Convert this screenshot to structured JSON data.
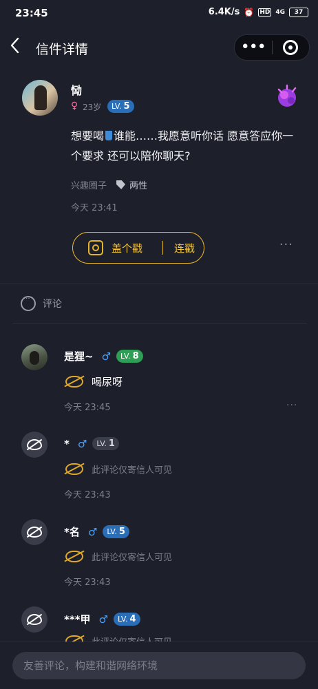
{
  "status_bar": {
    "time": "23:45",
    "speed": "6.4K/s",
    "alarm_icon": "alarm-icon",
    "hd": "HD",
    "signal": "4G",
    "battery": "37"
  },
  "nav": {
    "title": "信件详情",
    "back_icon": "chevron-left-icon",
    "more_icon": "more-dots-icon",
    "close_icon": "target-circle-icon"
  },
  "post": {
    "author": "恸",
    "gender_symbol": "♀",
    "age": "23岁",
    "level_prefix": "LV.",
    "level": "5",
    "content_before": "想要喝",
    "content_after": "谁能……我愿意听你话 愿意答应你一个要求 还可以陪你聊天?",
    "circle": "兴趣圈子",
    "tag": "两性",
    "time": "今天 23:41",
    "stamp_label": "盖个戳",
    "restamp_label": "连戳",
    "more": "···"
  },
  "comments_header": {
    "label": "评论"
  },
  "comments": [
    {
      "name": "是狸~",
      "gender": "♂",
      "level_prefix": "LV.",
      "level": "8",
      "text": "喝尿呀",
      "time": "今天 23:45",
      "more": "···"
    },
    {
      "name": "*",
      "gender": "♂",
      "level_prefix": "LV.",
      "level": "1",
      "text": "此评论仅寄信人可见",
      "time": "今天 23:43"
    },
    {
      "name": "*名",
      "gender": "♂",
      "level_prefix": "LV.",
      "level": "5",
      "text": "此评论仅寄信人可见",
      "time": "今天 23:43"
    },
    {
      "name": "***甲",
      "gender": "♂",
      "level_prefix": "LV.",
      "level": "4",
      "text": "此评论仅寄信人可见"
    }
  ],
  "input": {
    "placeholder": "友善评论，构建和谐网络环境"
  },
  "colors": {
    "background": "#1d1f2b",
    "accent_gold": "#e6b42a",
    "level_blue": "#2b6eb8",
    "level_green": "#2e9e56",
    "male_blue": "#4aa3ff",
    "female_pink": "#ff6aa2"
  }
}
